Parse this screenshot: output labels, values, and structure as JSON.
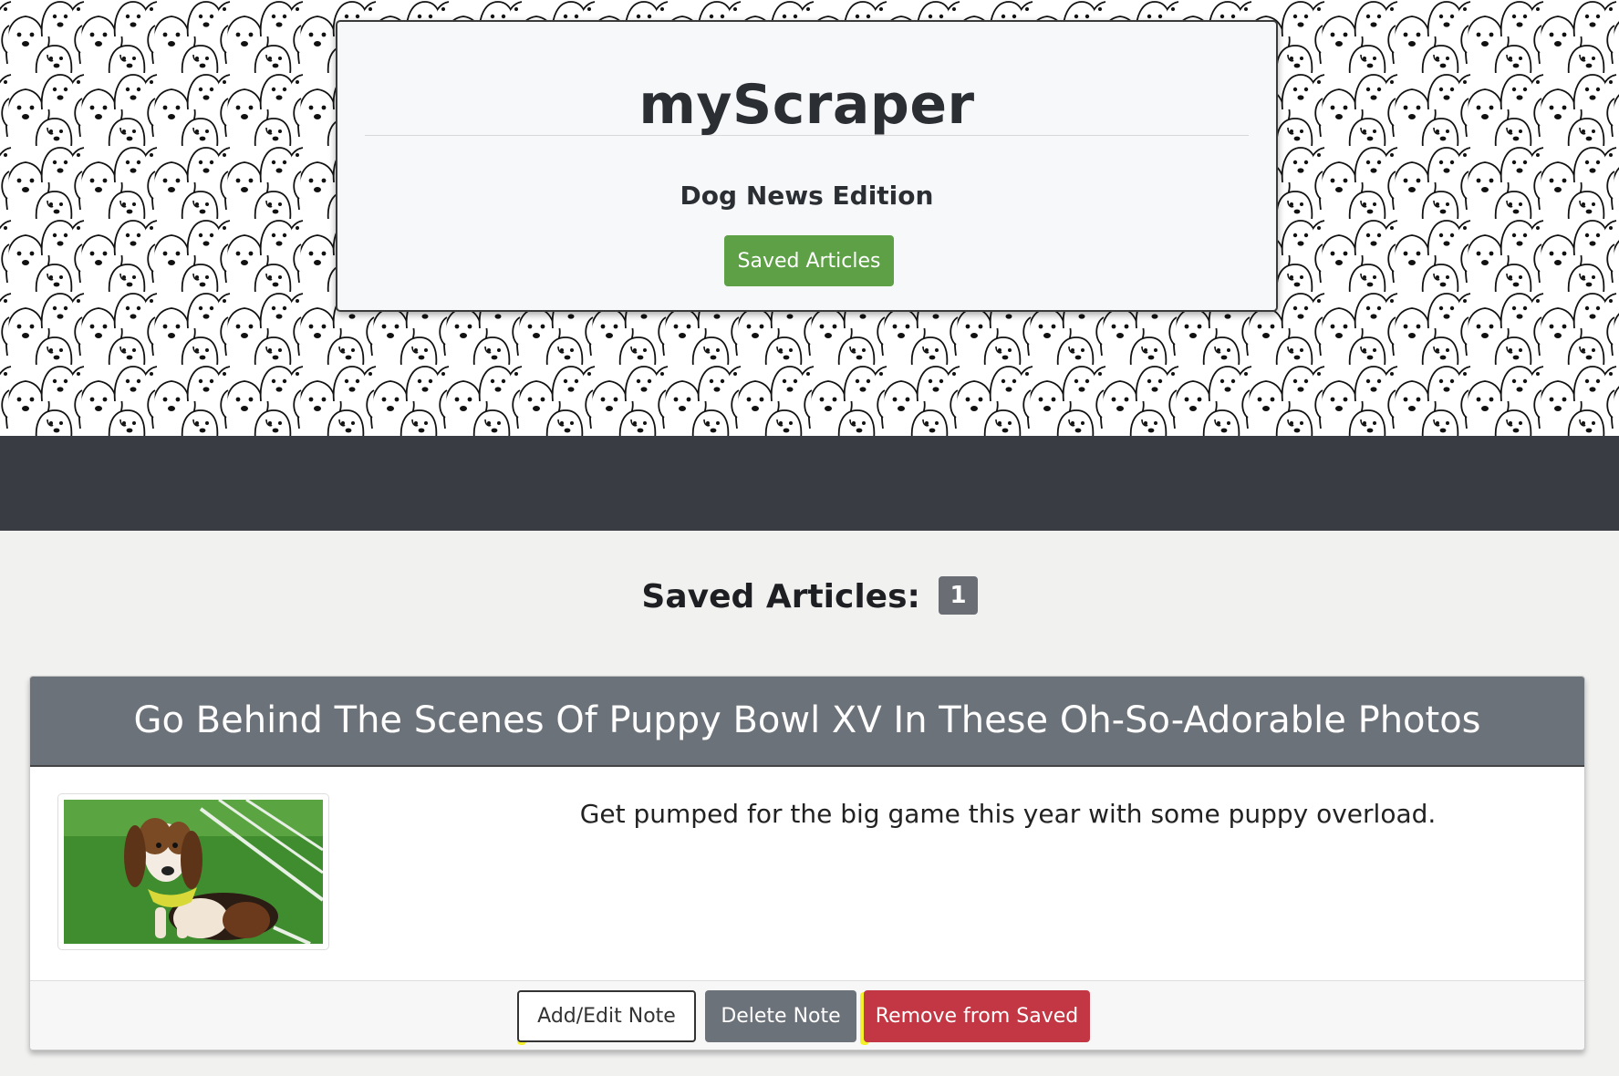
{
  "header": {
    "title": "myScraper",
    "subtitle": "Dog News Edition",
    "saved_articles_button": "Saved Articles"
  },
  "saved": {
    "heading": "Saved Articles:",
    "count": "1"
  },
  "article": {
    "title": "Go Behind The Scenes Of Puppy Bowl XV In These Oh-So-Adorable Photos",
    "summary": "Get pumped for the big game this year with some puppy overload.",
    "image_icon": "basset-puppy-photo",
    "buttons": {
      "note": "Add/Edit Note",
      "delete": "Delete Note",
      "remove": "Remove from Saved"
    }
  },
  "colors": {
    "navbar": "#393c43",
    "saved_button": "#5da046",
    "card_header": "#6c7279",
    "remove_button": "#c23743",
    "highlight": "#f4f12a"
  }
}
